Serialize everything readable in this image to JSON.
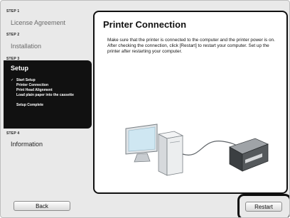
{
  "sidebar": {
    "step1": {
      "label": "STEP 1",
      "title": "License Agreement"
    },
    "step2": {
      "label": "STEP 2",
      "title": "Installation"
    },
    "step3": {
      "label": "STEP 3",
      "title": "Setup",
      "substeps": [
        {
          "text": "Start Setup",
          "check": "✓"
        },
        {
          "text": "Printer Connection",
          "check": ""
        },
        {
          "text": "Print Head Alignment",
          "check": ""
        },
        {
          "text": "Load plain paper into the cassette",
          "check": ""
        },
        {
          "text": "Setup Complete",
          "check": ""
        }
      ]
    },
    "step4": {
      "label": "STEP 4",
      "title": "Information"
    }
  },
  "panel": {
    "title": "Printer Connection",
    "body": "Make sure that the printer is connected to the computer and the printer power is on. After checking the connection, click [Restart] to restart your computer. Set up the printer after restarting your computer."
  },
  "buttons": {
    "back": "Back",
    "restart": "Restart"
  }
}
